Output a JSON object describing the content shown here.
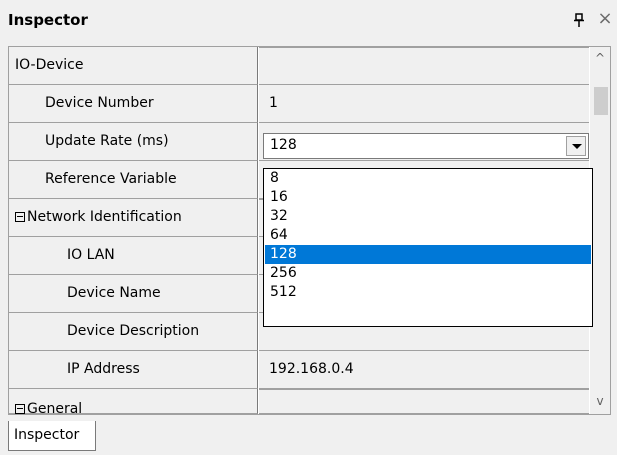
{
  "panel": {
    "title": "Inspector",
    "tab_label": "Inspector"
  },
  "icons": {
    "pin": "pin-icon",
    "close": "close-icon"
  },
  "rows": [
    {
      "name": "IO-Device",
      "value": ""
    },
    {
      "name": "Device Number",
      "value": "1"
    },
    {
      "name": "Update Rate (ms)",
      "value": "128"
    },
    {
      "name": "Reference Variable",
      "value": ""
    },
    {
      "name": "Network Identification",
      "value": ""
    },
    {
      "name": "IO LAN",
      "value": ""
    },
    {
      "name": "Device Name",
      "value": ""
    },
    {
      "name": "Device Description",
      "value": ""
    },
    {
      "name": "IP Address",
      "value": "192.168.0.4"
    },
    {
      "name": "General",
      "value": ""
    }
  ],
  "dropdown": {
    "options": [
      "8",
      "16",
      "32",
      "64",
      "128",
      "256",
      "512"
    ],
    "selected": "128"
  },
  "colors": {
    "selection": "#0078d7",
    "background": "#f0f0f0"
  }
}
